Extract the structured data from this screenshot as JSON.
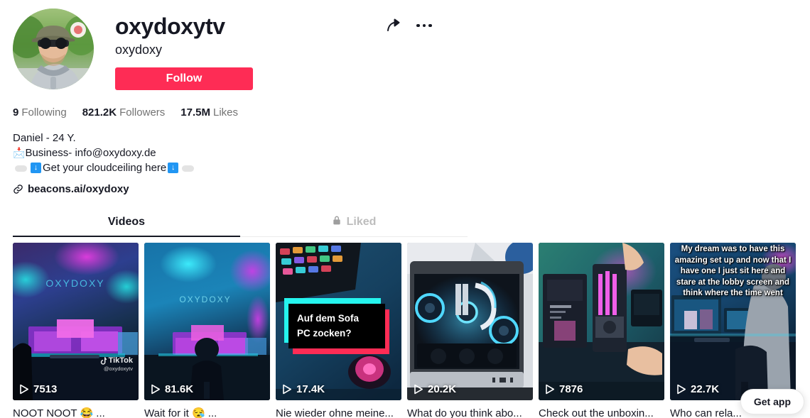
{
  "profile": {
    "username": "oxydoxytv",
    "nickname": "oxydoxy",
    "follow_label": "Follow",
    "avatar_alt": "avatar",
    "share_icon": "share-arrow-icon",
    "more_icon": "more-options-icon"
  },
  "stats": [
    {
      "value": "9",
      "label": "Following"
    },
    {
      "value": "821.2K",
      "label": "Followers"
    },
    {
      "value": "17.5M",
      "label": "Likes"
    }
  ],
  "bio": {
    "line1": "Daniel - 24 Y.",
    "line2_emoji": "📩",
    "line2": "Business- info@oxydoxy.de",
    "line3": "Get your cloudceiling here",
    "arrow_glyph": "↓",
    "link": "beacons.ai/oxydoxy",
    "link_icon": "link-icon"
  },
  "tabs": [
    {
      "label": "Videos",
      "active": true,
      "icon": null
    },
    {
      "label": "Liked",
      "active": false,
      "icon": "lock-icon"
    }
  ],
  "videos": [
    {
      "views": "7513",
      "caption": "NOOT NOOT 😂 ...",
      "overlay": null,
      "watermark": {
        "brand": "TikTok",
        "handle": "@oxydoxytv"
      },
      "art": "neon-purple-setup"
    },
    {
      "views": "81.6K",
      "caption": "Wait for it 😪 ...",
      "overlay": null,
      "watermark": null,
      "art": "blue-cloud-ceiling-setup"
    },
    {
      "views": "17.4K",
      "caption": "Nie wieder ohne meine...",
      "overlay": {
        "kind": "sofa-box",
        "line1": "Auf dem Sofa",
        "line2": "PC zocken?"
      },
      "watermark": null,
      "art": "keyboard-mouse-desk"
    },
    {
      "views": "20.2K",
      "caption": "What do you think abo...",
      "overlay": null,
      "watermark": null,
      "art": "pc-build-blue-rgb"
    },
    {
      "views": "7876",
      "caption": "Check out the unboxin...",
      "overlay": null,
      "watermark": null,
      "art": "gpu-unboxing-purple"
    },
    {
      "views": "22.7K",
      "caption": "Who can rela...",
      "overlay": {
        "kind": "dream-text",
        "text": "My dream was to have this amazing set up and now that I have one I just sit here and stare at the lobby screen and think where the time went"
      },
      "watermark": null,
      "art": "gamer-at-desk-blue"
    }
  ],
  "floating": {
    "get_app_label": "Get app"
  },
  "colors": {
    "accent": "#fe2c55",
    "text": "#161823",
    "muted": "#737373",
    "cyan": "#25f4ee"
  }
}
